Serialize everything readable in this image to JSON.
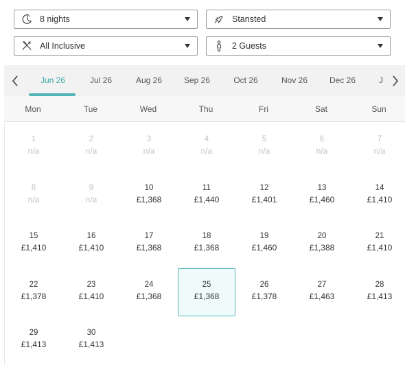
{
  "filters": {
    "nights": {
      "label": "8 nights",
      "icon": "moon-icon"
    },
    "airport": {
      "label": "Stansted",
      "icon": "plane-icon"
    },
    "board": {
      "label": "All Inclusive",
      "icon": "cutlery-icon"
    },
    "guests": {
      "label": "2 Guests",
      "icon": "person-icon"
    }
  },
  "months": [
    "Jun 26",
    "Jul 26",
    "Aug 26",
    "Sep 26",
    "Oct 26",
    "Nov 26",
    "Dec 26",
    "J"
  ],
  "active_month": "Jun 26",
  "weekdays": [
    "Mon",
    "Tue",
    "Wed",
    "Thu",
    "Fri",
    "Sat",
    "Sun"
  ],
  "days": [
    {
      "day": "1",
      "price": "n/a"
    },
    {
      "day": "2",
      "price": "n/a"
    },
    {
      "day": "3",
      "price": "n/a"
    },
    {
      "day": "4",
      "price": "n/a"
    },
    {
      "day": "5",
      "price": "n/a"
    },
    {
      "day": "6",
      "price": "n/a"
    },
    {
      "day": "7",
      "price": "n/a"
    },
    {
      "day": "8",
      "price": "n/a"
    },
    {
      "day": "9",
      "price": "n/a"
    },
    {
      "day": "10",
      "price": "£1,368"
    },
    {
      "day": "11",
      "price": "£1,440"
    },
    {
      "day": "12",
      "price": "£1,401"
    },
    {
      "day": "13",
      "price": "£1,460"
    },
    {
      "day": "14",
      "price": "£1,410"
    },
    {
      "day": "15",
      "price": "£1,410"
    },
    {
      "day": "16",
      "price": "£1,410"
    },
    {
      "day": "17",
      "price": "£1,368"
    },
    {
      "day": "18",
      "price": "£1,368"
    },
    {
      "day": "19",
      "price": "£1,460"
    },
    {
      "day": "20",
      "price": "£1,388"
    },
    {
      "day": "21",
      "price": "£1,410"
    },
    {
      "day": "22",
      "price": "£1,378"
    },
    {
      "day": "23",
      "price": "£1,410"
    },
    {
      "day": "24",
      "price": "£1,368"
    },
    {
      "day": "25",
      "price": "£1,368"
    },
    {
      "day": "26",
      "price": "£1,378"
    },
    {
      "day": "27",
      "price": "£1,463"
    },
    {
      "day": "28",
      "price": "£1,413"
    },
    {
      "day": "29",
      "price": "£1,413"
    },
    {
      "day": "30",
      "price": "£1,413"
    }
  ],
  "selected_day": "25",
  "colors": {
    "accent": "#52b5b8",
    "unavailable": "#c2c2c2",
    "selected_bg": "#effafa"
  }
}
